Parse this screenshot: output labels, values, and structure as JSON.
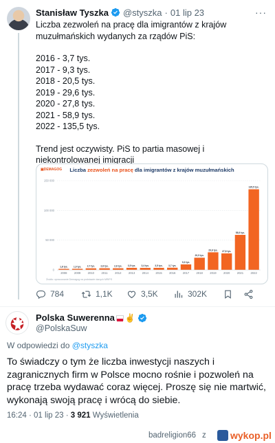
{
  "tweet": {
    "author_name": "Stanisław Tyszka",
    "author_handle": "@styszka",
    "date": "01 lip 23",
    "text_intro": "Liczba zezwoleń na pracę dla imigrantów z krajów muzułmańskich wydanych za rządów PiS:",
    "stats": [
      "2016 - 3,7 tys.",
      "2017 - 9,3 tys.",
      "2018 - 20,5 tys.",
      "2019 - 29,6 tys.",
      "2020 - 27,8 tys.",
      "2021 - 58,9 tys.",
      "2022 - 135,5 tys."
    ],
    "text_outro": "Trend jest oczywisty. PiS to partia masowej i niekontrolowanej imigracji",
    "actions": {
      "replies": "784",
      "retweets": "1,1K",
      "likes": "3,5K",
      "views": "302K"
    }
  },
  "chart_data": {
    "type": "bar",
    "logo": "DEMAGOG",
    "title_pre": "Liczba ",
    "title_highlight": "zezwoleń na pracę",
    "title_post": " dla imigrantów z krajów muzułmańskich",
    "categories": [
      "2008",
      "2009",
      "2010",
      "2011",
      "2012",
      "2013",
      "2014",
      "2015",
      "2016",
      "2017",
      "2018",
      "2019",
      "2020",
      "2021",
      "2022"
    ],
    "values": [
      1.8,
      1.9,
      2.7,
      2.8,
      2.8,
      3.5,
      3.4,
      3.5,
      3.7,
      9.3,
      20.5,
      29.6,
      27.8,
      58.9,
      135.5
    ],
    "value_labels": [
      "1,8 tys.",
      "1,9 tys.",
      "2,7 tys.",
      "2,8 tys.",
      "2,8 tys.",
      "3,5 tys.",
      "3,4 tys.",
      "3,5 tys.",
      "3,7 tys.",
      "9,3 tys.",
      "20,5 tys.",
      "29,6 tys.",
      "27,8 tys.",
      "58,9 tys.",
      "135,5 tys."
    ],
    "yticks": [
      "0",
      "50 000",
      "100 000",
      "150 000"
    ],
    "ylim": [
      0,
      150
    ],
    "grid": true,
    "source": "Źródło: opracowanie Demagog na podstawie danych MRiPS",
    "bar_color": "#f26522"
  },
  "reply": {
    "author_name": "Polska Suwerenna",
    "peace_emoji": "✌",
    "author_handle": "@PolskaSuw",
    "reply_to_prefix": "W odpowiedzi do ",
    "reply_to_handle": "@styszka",
    "text": "To świadczy o tym że liczba inwestycji naszych i zagranicznych firm w Polsce mocno rośnie i pozwoleń na pracę trzeba wydawać coraz więcej. Proszę się nie martwić, wykonają swoją pracę i wrócą do siebie.",
    "time": "16:24",
    "dot": "·",
    "date": "01 lip 23",
    "views_count": "3 921",
    "views_label": "Wyświetlenia"
  },
  "footer": {
    "username": "badreligion66",
    "separator": "z",
    "site": "wykop.pl"
  },
  "colors": {
    "verified": "#1d9bf0",
    "link": "#1d9bf0",
    "secondary_text": "#536471",
    "chart_bar": "#f26522",
    "chart_title": "#1d3a66"
  }
}
